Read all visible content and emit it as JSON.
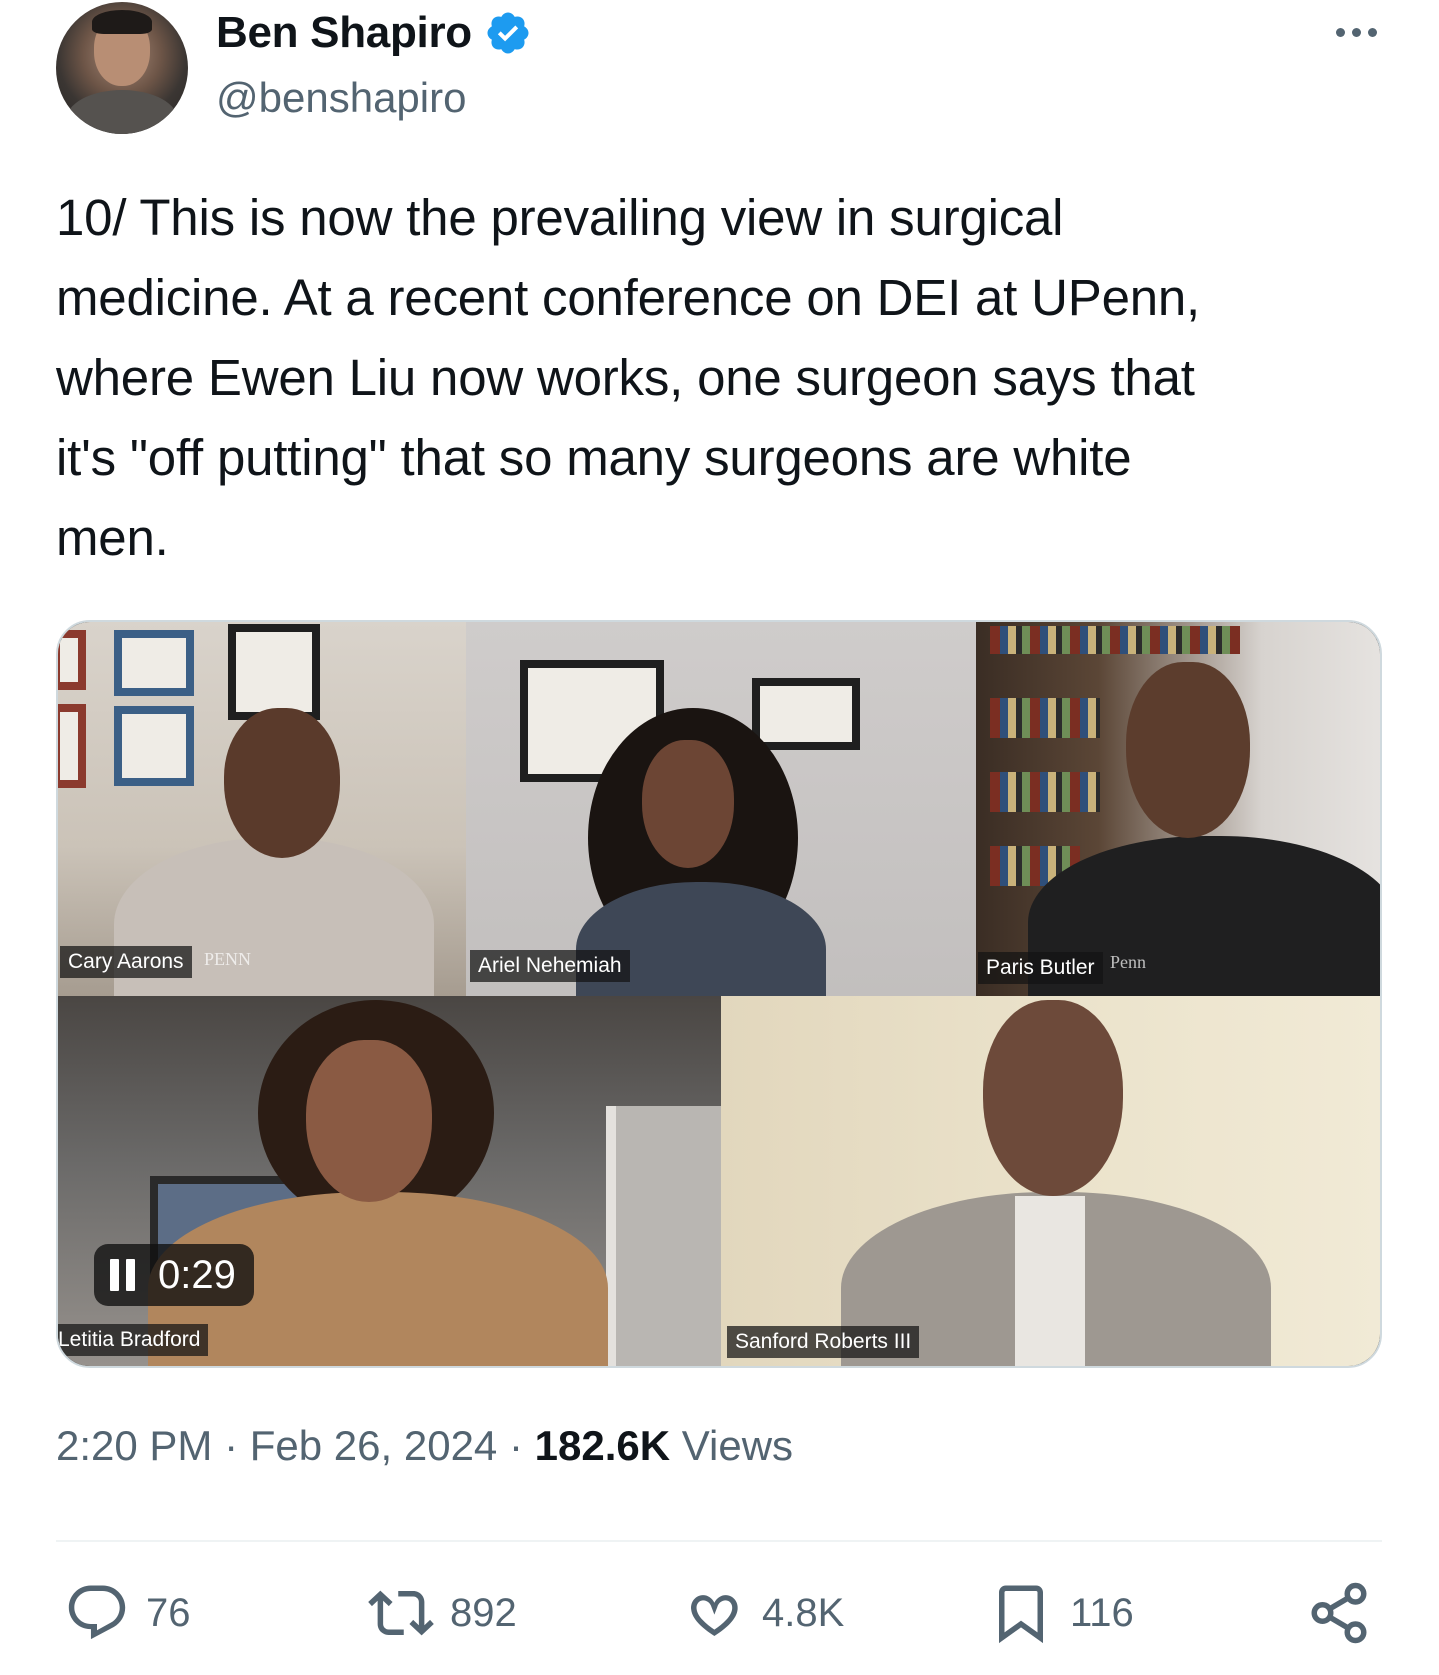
{
  "author": {
    "name": "Ben Shapiro",
    "handle": "@benshapiro",
    "verified_color": "#1d9bf0"
  },
  "tweet": {
    "text": "10/ This is now the prevailing view in surgical\nmedicine. At a recent conference on DEI at UPenn,\nwhere Ewen Liu now works, one surgeon says that\nit's \"off putting\" that so many surgeons are white\nmen."
  },
  "media": {
    "participants": [
      {
        "name": "Cary Aarons",
        "logo": "PENN"
      },
      {
        "name": "Ariel Nehemiah"
      },
      {
        "name": "Paris Butler",
        "logo": "Penn"
      },
      {
        "name": "Letitia Bradford"
      },
      {
        "name": "Sanford Roberts III"
      }
    ],
    "video": {
      "timecode": "0:29",
      "state_icon": "pause-icon"
    }
  },
  "meta": {
    "time": "2:20 PM",
    "separator": "·",
    "date": "Feb 26, 2024",
    "views_count": "182.6K",
    "views_label": "Views"
  },
  "actions": {
    "replies": "76",
    "reposts": "892",
    "likes": "4.8K",
    "bookmarks": "116",
    "icons": [
      "reply-icon",
      "repost-icon",
      "like-icon",
      "bookmark-icon",
      "share-icon"
    ]
  }
}
